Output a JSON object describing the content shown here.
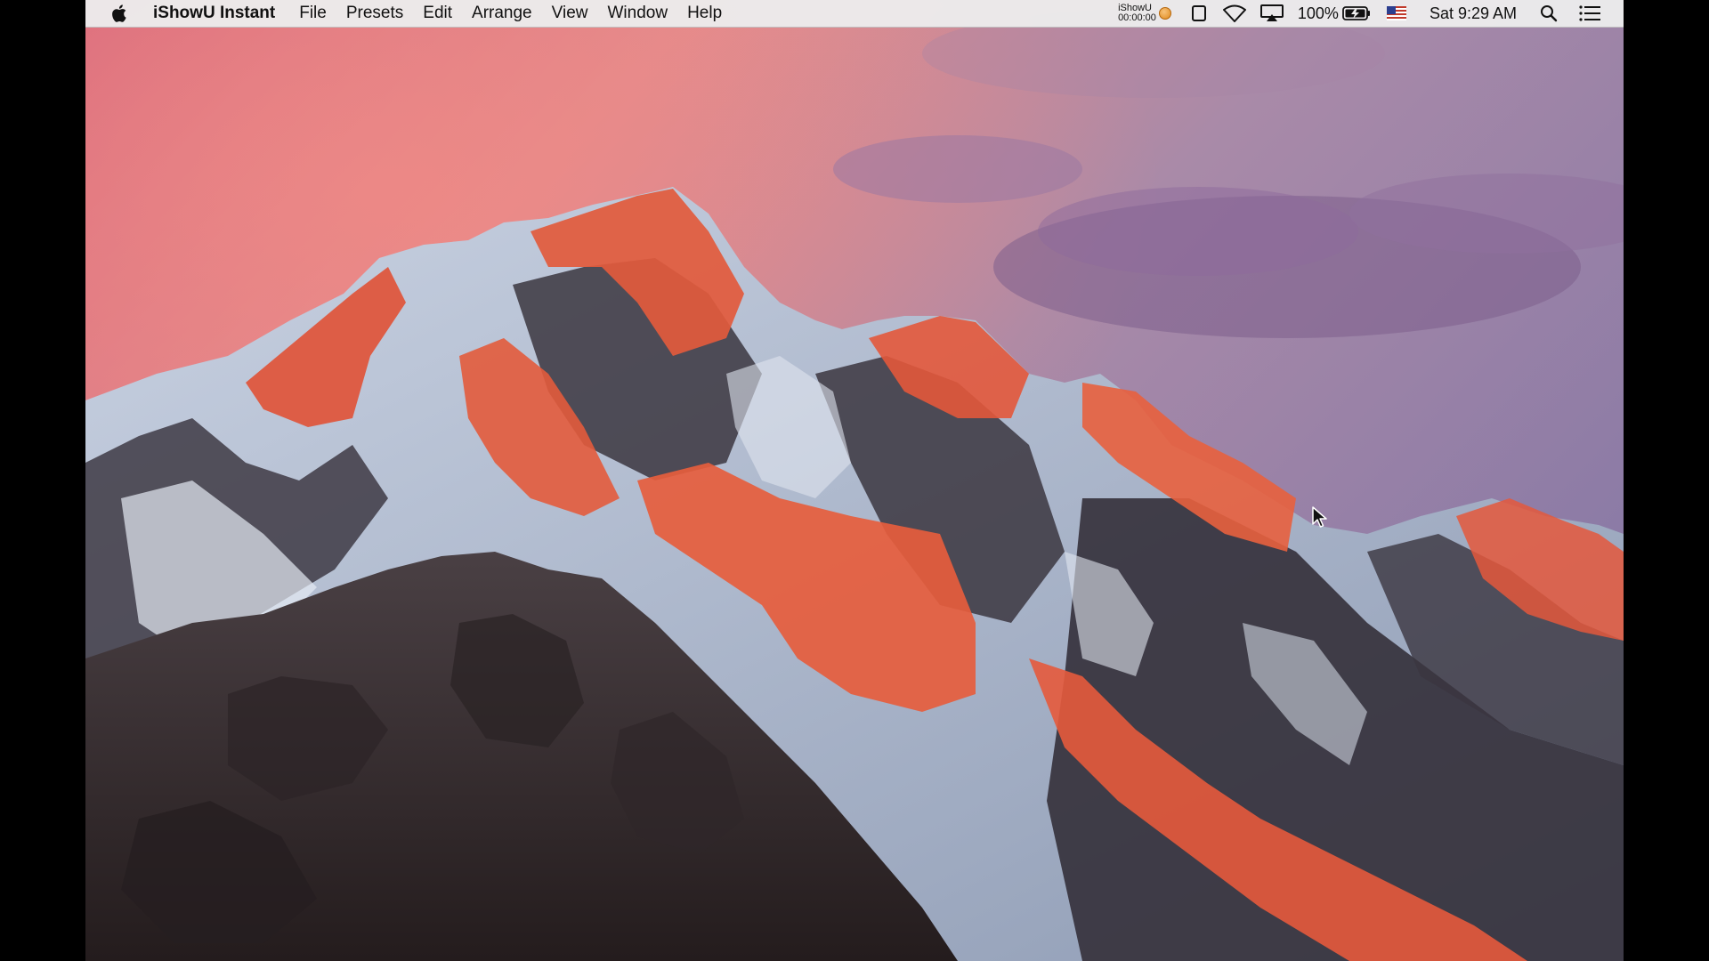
{
  "menubar": {
    "app_name": "iShowU Instant",
    "menus": [
      {
        "label": "File"
      },
      {
        "label": "Presets"
      },
      {
        "label": "Edit"
      },
      {
        "label": "Arrange"
      },
      {
        "label": "View"
      },
      {
        "label": "Window"
      },
      {
        "label": "Help"
      }
    ],
    "status": {
      "ishowu_title": "iShowU",
      "ishowu_timer": "00:00:00",
      "battery_percent": "100%",
      "clock": "Sat 9:29 AM"
    },
    "icons": [
      "apple-icon",
      "ishowu-record-icon",
      "display-icon",
      "wifi-icon",
      "airplay-icon",
      "battery-charging-icon",
      "us-flag-icon",
      "spotlight-search-icon",
      "notification-center-icon"
    ]
  },
  "desktop": {
    "wallpaper": "mountain-sunset",
    "colors": {
      "sky_pink": "#e88a8a",
      "sky_purple": "#8e6a9e",
      "peak_orange": "#e0573a",
      "snow": "#dfe4ee",
      "rock_dark": "#3a3234"
    }
  }
}
